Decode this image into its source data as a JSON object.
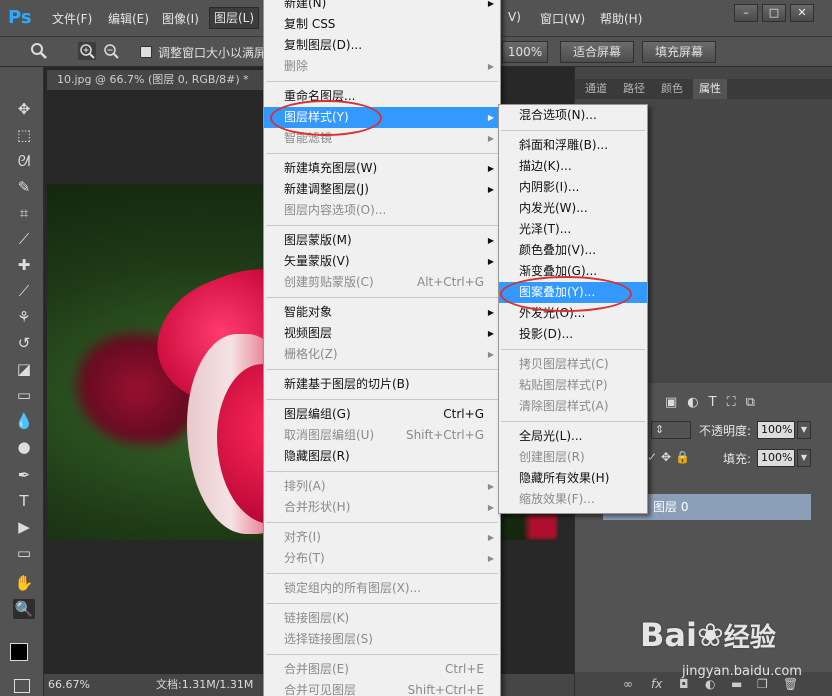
{
  "app": {
    "logo": "Ps"
  },
  "menubar": {
    "items": [
      {
        "label": "文件(F)"
      },
      {
        "label": "编辑(E)"
      },
      {
        "label": "图像(I)"
      },
      {
        "label": "图层(L)"
      },
      {
        "label": "V)"
      },
      {
        "label": "窗口(W)"
      },
      {
        "label": "帮助(H)"
      }
    ],
    "window_controls": [
      "–",
      "□",
      "✕"
    ]
  },
  "options_bar": {
    "resize_label": "调整窗口大小以满屏",
    "zoom_value": "100%",
    "fit_screen": "适合屏幕",
    "fill_screen": "填充屏幕"
  },
  "document": {
    "tab_title": "10.jpg @ 66.7% (图层 0, RGB/8#) *"
  },
  "status": {
    "zoom": "66.67%",
    "doc_info": "文档:1.31M/1.31M"
  },
  "right_panel": {
    "tabs": [
      "通道",
      "路径",
      "颜色",
      "属性"
    ],
    "opacity_label": "不透明度:",
    "opacity_value": "100%",
    "fill_label": "填充:",
    "fill_value": "100%",
    "layer_name": "图层 0",
    "bottom_icons": [
      "∞",
      "fx"
    ]
  },
  "layer_menu": {
    "items": [
      {
        "label": "新建(N)",
        "arrow": true
      },
      {
        "label": "复制 CSS"
      },
      {
        "label": "复制图层(D)..."
      },
      {
        "label": "删除",
        "disabled": true,
        "arrow": true
      },
      {
        "sep": true
      },
      {
        "label": "重命名图层..."
      },
      {
        "label": "图层样式(Y)",
        "arrow": true,
        "highlight": true
      },
      {
        "label": "智能滤镜",
        "disabled": true,
        "arrow": true
      },
      {
        "sep": true
      },
      {
        "label": "新建填充图层(W)",
        "arrow": true
      },
      {
        "label": "新建调整图层(J)",
        "arrow": true
      },
      {
        "label": "图层内容选项(O)...",
        "disabled": true
      },
      {
        "sep": true
      },
      {
        "label": "图层蒙版(M)",
        "arrow": true
      },
      {
        "label": "矢量蒙版(V)",
        "arrow": true
      },
      {
        "label": "创建剪贴蒙版(C)",
        "shortcut": "Alt+Ctrl+G",
        "disabled": true
      },
      {
        "sep": true
      },
      {
        "label": "智能对象",
        "arrow": true
      },
      {
        "label": "视频图层",
        "arrow": true
      },
      {
        "label": "栅格化(Z)",
        "disabled": true,
        "arrow": true
      },
      {
        "sep": true
      },
      {
        "label": "新建基于图层的切片(B)"
      },
      {
        "sep": true
      },
      {
        "label": "图层编组(G)",
        "shortcut": "Ctrl+G"
      },
      {
        "label": "取消图层编组(U)",
        "shortcut": "Shift+Ctrl+G",
        "disabled": true
      },
      {
        "label": "隐藏图层(R)"
      },
      {
        "sep": true
      },
      {
        "label": "排列(A)",
        "disabled": true,
        "arrow": true
      },
      {
        "label": "合并形状(H)",
        "disabled": true,
        "arrow": true
      },
      {
        "sep": true
      },
      {
        "label": "对齐(I)",
        "disabled": true,
        "arrow": true
      },
      {
        "label": "分布(T)",
        "disabled": true,
        "arrow": true
      },
      {
        "sep": true
      },
      {
        "label": "锁定组内的所有图层(X)...",
        "disabled": true
      },
      {
        "sep": true
      },
      {
        "label": "链接图层(K)",
        "disabled": true
      },
      {
        "label": "选择链接图层(S)",
        "disabled": true
      },
      {
        "sep": true
      },
      {
        "label": "合并图层(E)",
        "shortcut": "Ctrl+E",
        "disabled": true
      },
      {
        "label": "合并可见图层",
        "shortcut": "Shift+Ctrl+E",
        "disabled": true
      }
    ]
  },
  "style_submenu": {
    "items": [
      {
        "label": "混合选项(N)..."
      },
      {
        "sep": true
      },
      {
        "label": "斜面和浮雕(B)..."
      },
      {
        "label": "描边(K)..."
      },
      {
        "label": "内阴影(I)..."
      },
      {
        "label": "内发光(W)..."
      },
      {
        "label": "光泽(T)..."
      },
      {
        "label": "颜色叠加(V)..."
      },
      {
        "label": "渐变叠加(G)..."
      },
      {
        "label": "图案叠加(Y)...",
        "highlight": true
      },
      {
        "label": "外发光(O)..."
      },
      {
        "label": "投影(D)..."
      },
      {
        "sep": true
      },
      {
        "label": "拷贝图层样式(C)",
        "disabled": true
      },
      {
        "label": "粘贴图层样式(P)",
        "disabled": true
      },
      {
        "label": "清除图层样式(A)",
        "disabled": true
      },
      {
        "sep": true
      },
      {
        "label": "全局光(L)..."
      },
      {
        "label": "创建图层(R)",
        "disabled": true
      },
      {
        "label": "隐藏所有效果(H)"
      },
      {
        "label": "缩放效果(F)...",
        "disabled": true
      }
    ]
  },
  "watermark": {
    "brand": "Bai",
    "brand2": "经验",
    "url": "jingyan.baidu.com"
  },
  "colors": {
    "highlight": "#3399ff",
    "annotation_ring": "#d93030"
  }
}
